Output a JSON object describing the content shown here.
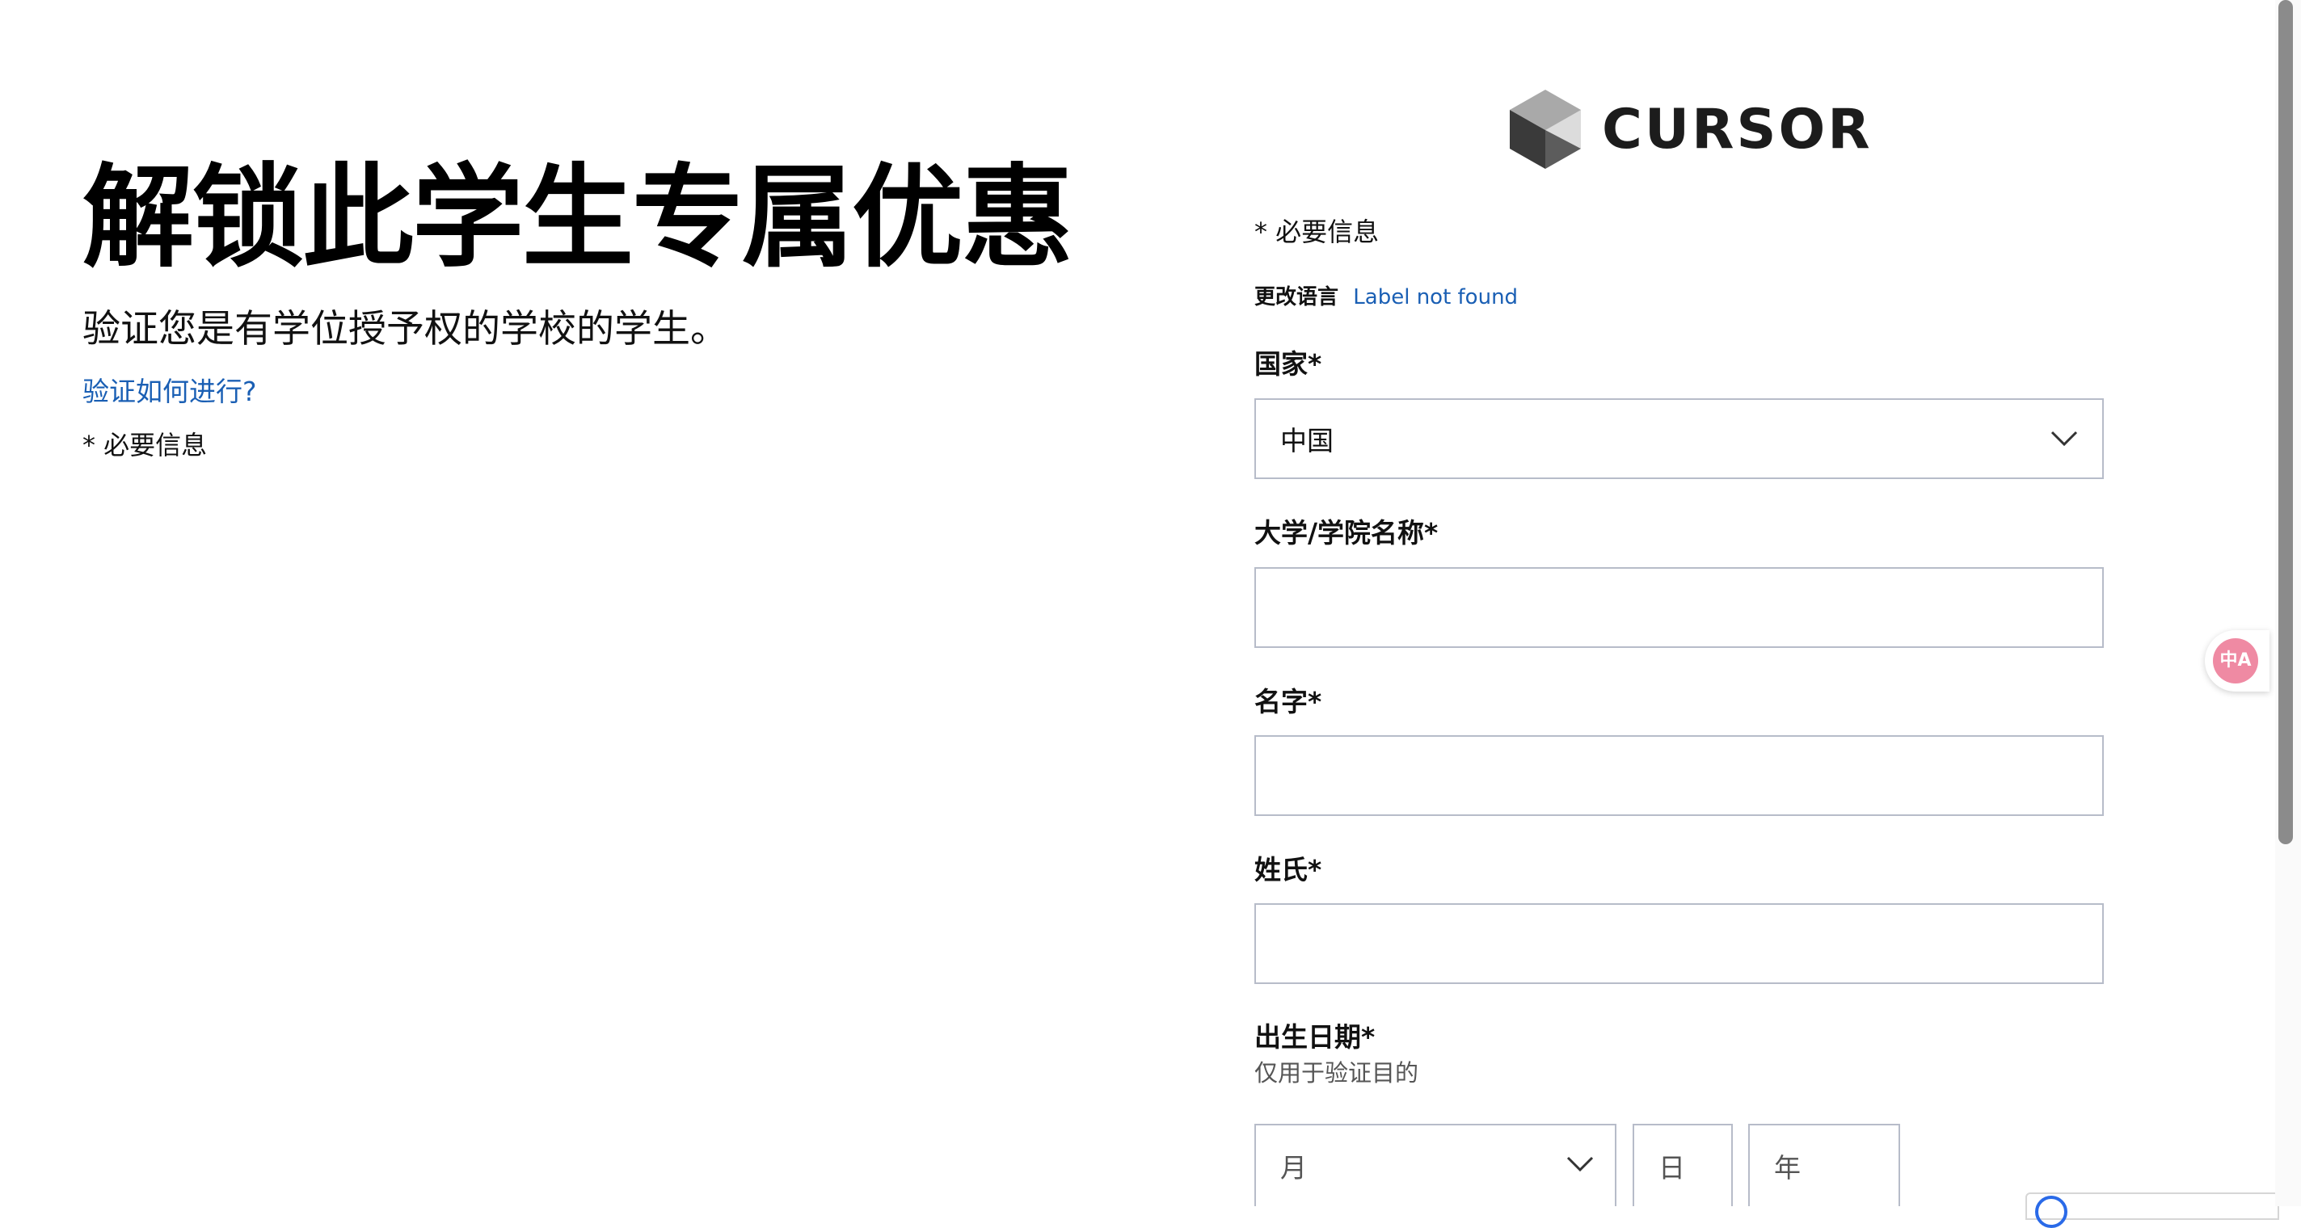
{
  "hero": {
    "title": "解锁此学生专属优惠",
    "subtitle": "验证您是有学位授予权的学校的学生。",
    "help_link": "验证如何进行?",
    "required_note": "* 必要信息"
  },
  "brand": {
    "logo_icon": "cube-logo-icon",
    "name": "CURSOR"
  },
  "form": {
    "required_note": "* 必要信息",
    "language": {
      "label": "更改语言",
      "link": "Label not found"
    },
    "country": {
      "label": "国家*",
      "value": "中国"
    },
    "university": {
      "label": "大学/学院名称*",
      "value": ""
    },
    "first_name": {
      "label": "名字*",
      "value": ""
    },
    "last_name": {
      "label": "姓氏*",
      "value": ""
    },
    "birth_date": {
      "label": "出生日期*",
      "hint": "仅用于验证目的",
      "month_placeholder": "月",
      "day_placeholder": "日",
      "year_placeholder": "年"
    }
  },
  "widgets": {
    "translate_icon": "translate-icon",
    "translate_glyph": "中A"
  },
  "colors": {
    "link": "#1a5fb4",
    "border": "#b7bcc9",
    "translate_accent": "#ef8aa3"
  }
}
